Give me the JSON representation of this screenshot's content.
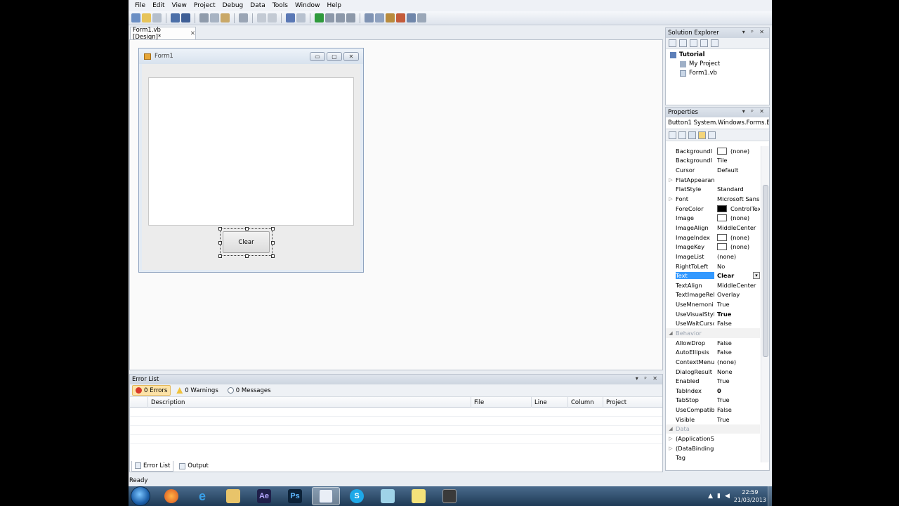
{
  "menu": [
    "File",
    "Edit",
    "View",
    "Project",
    "Debug",
    "Data",
    "Tools",
    "Window",
    "Help"
  ],
  "document_tab": {
    "label": "Form1.vb [Design]*",
    "close": "✕"
  },
  "form": {
    "title": "Form1",
    "button_label": "Clear",
    "window_buttons": {
      "minimize": "▭",
      "maximize": "▢",
      "close": "✕"
    }
  },
  "error_list": {
    "title": "Error List",
    "filters": {
      "errors": "0 Errors",
      "warnings": "0 Warnings",
      "messages": "0 Messages"
    },
    "columns": [
      "Description",
      "File",
      "Line",
      "Column",
      "Project"
    ],
    "title_controls": "▾ ᵖ ✕"
  },
  "bottom_tabs": {
    "error_list": "Error List",
    "output": "Output"
  },
  "status": "Ready",
  "solution_explorer": {
    "title": "Solution Explorer",
    "title_controls": "▾ ᵖ ✕",
    "solution": "Tutorial",
    "items": [
      "My Project",
      "Form1.vb"
    ]
  },
  "properties": {
    "title": "Properties",
    "title_controls": "▾ ᵖ ✕",
    "object_selector": "Button1 System.Windows.Forms.B",
    "rows": [
      {
        "name": "BackgroundI",
        "value": "(none)"
      },
      {
        "name": "BackgroundI",
        "value": "Tile"
      },
      {
        "name": "Cursor",
        "value": "Default"
      },
      {
        "name": "FlatAppearan",
        "value": ""
      },
      {
        "name": "FlatStyle",
        "value": "Standard"
      },
      {
        "name": "Font",
        "value": "Microsoft Sans S"
      },
      {
        "name": "ForeColor",
        "value": "ControlTex"
      },
      {
        "name": "Image",
        "value": "(none)"
      },
      {
        "name": "ImageAlign",
        "value": "MiddleCenter"
      },
      {
        "name": "ImageIndex",
        "value": "(none)"
      },
      {
        "name": "ImageKey",
        "value": "(none)"
      },
      {
        "name": "ImageList",
        "value": "(none)"
      },
      {
        "name": "RightToLeft",
        "value": "No"
      },
      {
        "name": "Text",
        "value": "Clear"
      },
      {
        "name": "TextAlign",
        "value": "MiddleCenter"
      },
      {
        "name": "TextImageRel",
        "value": "Overlay"
      },
      {
        "name": "UseMnemoni",
        "value": "True"
      },
      {
        "name": "UseVisualStyl",
        "value": "True"
      },
      {
        "name": "UseWaitCursc",
        "value": "False"
      },
      {
        "name": "Behavior",
        "value": ""
      },
      {
        "name": "AllowDrop",
        "value": "False"
      },
      {
        "name": "AutoEllipsis",
        "value": "False"
      },
      {
        "name": "ContextMenu",
        "value": "(none)"
      },
      {
        "name": "DialogResult",
        "value": "None"
      },
      {
        "name": "Enabled",
        "value": "True"
      },
      {
        "name": "TabIndex",
        "value": "0"
      },
      {
        "name": "TabStop",
        "value": "True"
      },
      {
        "name": "UseCompatib",
        "value": "False"
      },
      {
        "name": "Visible",
        "value": "True"
      },
      {
        "name": "Data",
        "value": ""
      },
      {
        "name": "(ApplicationS",
        "value": ""
      },
      {
        "name": "(DataBinding:",
        "value": ""
      },
      {
        "name": "Tag",
        "value": ""
      }
    ]
  },
  "taskbar": {
    "apps": [
      "Ae",
      "Ps"
    ],
    "clock_time": "22:59",
    "clock_date": "21/03/2013"
  },
  "colors": {
    "selection": "#3399ff",
    "taskbar": "#1e3a56",
    "filter_active": "#fde3a7"
  }
}
